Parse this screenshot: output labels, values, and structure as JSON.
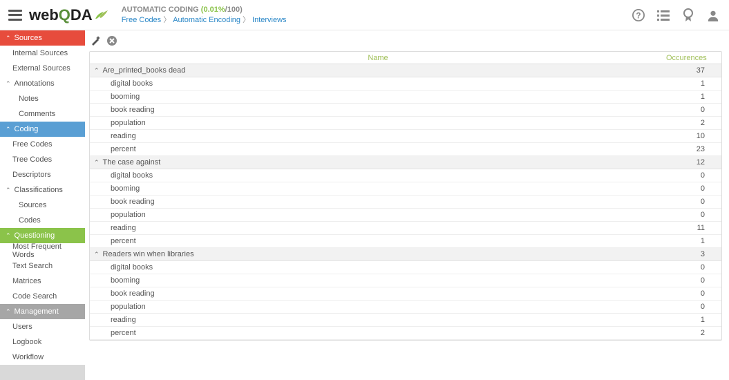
{
  "header": {
    "title": "AUTOMATIC CODING",
    "percent": "(0.01%",
    "percent_max": "/100)",
    "breadcrumb": [
      {
        "label": "Free Codes"
      },
      {
        "label": "Automatic Encoding"
      },
      {
        "label": "Interviews"
      }
    ]
  },
  "sidebar": {
    "sources": {
      "label": "Sources",
      "items": [
        "Internal Sources",
        "External Sources"
      ]
    },
    "annotations": {
      "label": "Annotations",
      "items": [
        "Notes",
        "Comments"
      ]
    },
    "coding": {
      "label": "Coding",
      "items": [
        "Free Codes",
        "Tree Codes",
        "Descriptors"
      ]
    },
    "classifications": {
      "label": "Classifications",
      "items": [
        "Sources",
        "Codes"
      ]
    },
    "questioning": {
      "label": "Questioning",
      "items": [
        "Most Frequent Words",
        "Text Search",
        "Matrices",
        "Code Search"
      ]
    },
    "management": {
      "label": "Management",
      "items": [
        "Users",
        "Logbook",
        "Workflow"
      ]
    }
  },
  "table": {
    "headers": {
      "name": "Name",
      "occ": "Occurences"
    },
    "groups": [
      {
        "name": "Are_printed_books dead",
        "occ": 37,
        "rows": [
          {
            "name": "digital books",
            "occ": 1
          },
          {
            "name": "booming",
            "occ": 1
          },
          {
            "name": "book reading",
            "occ": 0
          },
          {
            "name": "population",
            "occ": 2
          },
          {
            "name": "reading",
            "occ": 10
          },
          {
            "name": "percent",
            "occ": 23
          }
        ]
      },
      {
        "name": "The case against",
        "occ": 12,
        "rows": [
          {
            "name": "digital books",
            "occ": 0
          },
          {
            "name": "booming",
            "occ": 0
          },
          {
            "name": "book reading",
            "occ": 0
          },
          {
            "name": "population",
            "occ": 0
          },
          {
            "name": "reading",
            "occ": 11
          },
          {
            "name": "percent",
            "occ": 1
          }
        ]
      },
      {
        "name": "Readers win when libraries",
        "occ": 3,
        "rows": [
          {
            "name": "digital books",
            "occ": 0
          },
          {
            "name": "booming",
            "occ": 0
          },
          {
            "name": "book reading",
            "occ": 0
          },
          {
            "name": "population",
            "occ": 0
          },
          {
            "name": "reading",
            "occ": 1
          },
          {
            "name": "percent",
            "occ": 2
          }
        ]
      }
    ]
  }
}
